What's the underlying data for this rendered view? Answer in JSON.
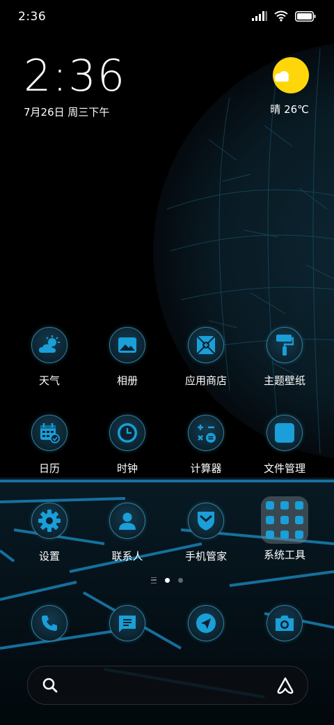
{
  "status_bar": {
    "time": "2:36",
    "icons": [
      "signal-icon",
      "wifi-icon",
      "battery-icon"
    ]
  },
  "clock_widget": {
    "time": "2:36",
    "date": "7月26日 周三下午"
  },
  "weather_widget": {
    "icon": "sun-cloud-icon",
    "text": "晴 26℃"
  },
  "apps": [
    {
      "label": "天气",
      "icon": "weather-icon"
    },
    {
      "label": "相册",
      "icon": "gallery-icon"
    },
    {
      "label": "应用商店",
      "icon": "app-store-icon"
    },
    {
      "label": "主题壁纸",
      "icon": "theme-brush-icon"
    },
    {
      "label": "日历",
      "icon": "calendar-icon"
    },
    {
      "label": "时钟",
      "icon": "clock-icon"
    },
    {
      "label": "计算器",
      "icon": "calculator-icon"
    },
    {
      "label": "文件管理",
      "icon": "file-manager-icon"
    },
    {
      "label": "设置",
      "icon": "settings-gear-icon"
    },
    {
      "label": "联系人",
      "icon": "contacts-icon"
    },
    {
      "label": "手机管家",
      "icon": "security-shield-icon"
    },
    {
      "label": "系统工具",
      "icon": "folder-icon"
    }
  ],
  "dock": [
    {
      "icon": "phone-icon"
    },
    {
      "icon": "messages-icon"
    },
    {
      "icon": "browser-icon"
    },
    {
      "icon": "camera-icon"
    }
  ],
  "page_indicator": {
    "pages": 2,
    "active": 1
  },
  "search_bar": {
    "left_icon": "search-icon",
    "right_icon": "assistant-icon"
  },
  "colors": {
    "accent": "#1a9fd8",
    "icon_ring": "#3a7f99",
    "sun": "#ffd60a"
  }
}
